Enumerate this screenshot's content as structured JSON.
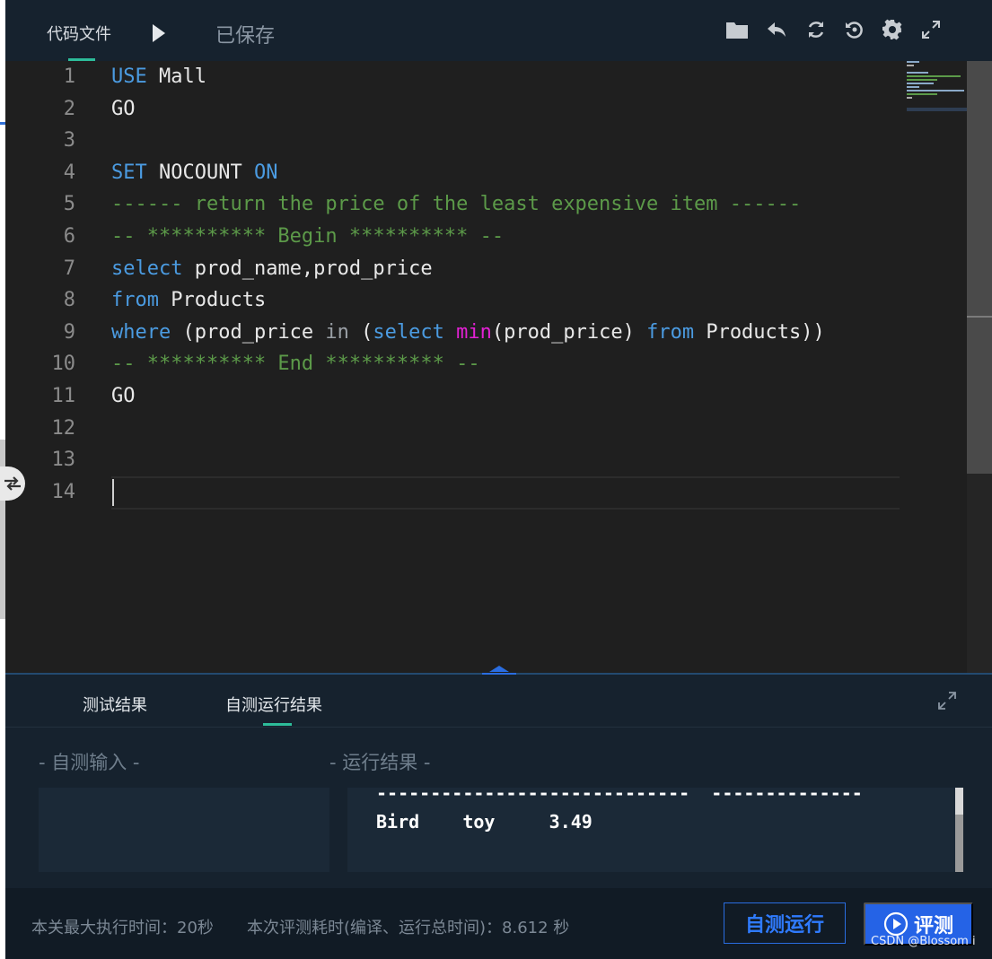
{
  "header": {
    "file_tab": "代码文件",
    "run_icon": "play-icon",
    "save_status": "已保存",
    "tools": [
      "folder-icon",
      "undo-icon",
      "refresh-icon",
      "history-icon",
      "gear-icon",
      "fullscreen-icon"
    ]
  },
  "editor": {
    "lines": [
      {
        "n": "1",
        "tokens": [
          {
            "t": "USE",
            "c": "kw"
          },
          {
            "t": " Mall",
            "c": ""
          }
        ]
      },
      {
        "n": "2",
        "tokens": [
          {
            "t": "GO",
            "c": ""
          }
        ]
      },
      {
        "n": "3",
        "tokens": []
      },
      {
        "n": "4",
        "tokens": [
          {
            "t": "SET",
            "c": "kw"
          },
          {
            "t": " NOCOUNT ",
            "c": ""
          },
          {
            "t": "ON",
            "c": "kw"
          }
        ]
      },
      {
        "n": "5",
        "tokens": [
          {
            "t": "------ return the price of the least expensive item ------",
            "c": "cm"
          }
        ]
      },
      {
        "n": "6",
        "tokens": [
          {
            "t": "-- ********** Begin ********** --",
            "c": "cm"
          }
        ]
      },
      {
        "n": "7",
        "tokens": [
          {
            "t": "select",
            "c": "kw"
          },
          {
            "t": " prod_name,prod_price",
            "c": ""
          }
        ]
      },
      {
        "n": "8",
        "tokens": [
          {
            "t": "from",
            "c": "kw"
          },
          {
            "t": " Products",
            "c": ""
          }
        ]
      },
      {
        "n": "9",
        "tokens": [
          {
            "t": "where",
            "c": "kw"
          },
          {
            "t": " (prod_price ",
            "c": ""
          },
          {
            "t": "in",
            "c": "op"
          },
          {
            "t": " (",
            "c": ""
          },
          {
            "t": "select",
            "c": "kw"
          },
          {
            "t": " ",
            "c": ""
          },
          {
            "t": "min",
            "c": "fn"
          },
          {
            "t": "(prod_price) ",
            "c": ""
          },
          {
            "t": "from",
            "c": "kw"
          },
          {
            "t": " Products))",
            "c": ""
          }
        ]
      },
      {
        "n": "10",
        "tokens": [
          {
            "t": "-- ********** End ********** --",
            "c": "cm"
          }
        ]
      },
      {
        "n": "11",
        "tokens": [
          {
            "t": "GO",
            "c": ""
          }
        ]
      },
      {
        "n": "12",
        "tokens": []
      },
      {
        "n": "13",
        "tokens": []
      },
      {
        "n": "14",
        "tokens": []
      }
    ]
  },
  "results": {
    "tabs": [
      "测试结果",
      "自测运行结果"
    ],
    "active_tab": "自测运行结果",
    "input_label": "- 自测输入 -",
    "output_label": "- 运行结果 -",
    "output_lines": [
      "-----------------------------  --------------",
      "Bird    toy     3.49"
    ]
  },
  "footer": {
    "max_time": "本关最大执行时间：20秒",
    "elapsed": "本次评测耗时(编译、运行总时间)：8.612 秒",
    "self_run_button": "自测运行",
    "judge_button": "评测",
    "watermark": "CSDN @Blossom i"
  },
  "colors": {
    "accent": "#2dbc9a",
    "keyword": "#4b9be1",
    "function": "#e321d4",
    "comment": "#5c9a49",
    "button_primary": "#2563e6"
  }
}
